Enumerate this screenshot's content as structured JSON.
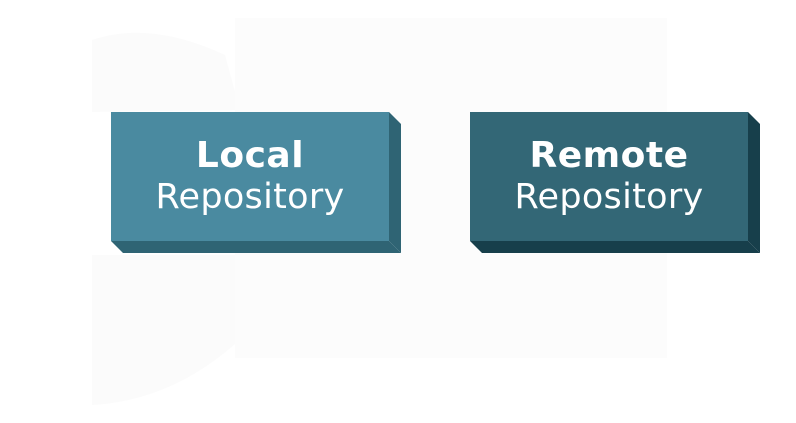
{
  "colors": {
    "local_face": "#4a8aa0",
    "local_edge": "#2f6474",
    "remote_face": "#336776",
    "remote_edge": "#173f4b",
    "background": "#ffffff",
    "faint_shape": "#fafafa"
  },
  "local": {
    "title": "Local",
    "subtitle": "Repository"
  },
  "remote": {
    "title": "Remote",
    "subtitle": "Repository"
  }
}
